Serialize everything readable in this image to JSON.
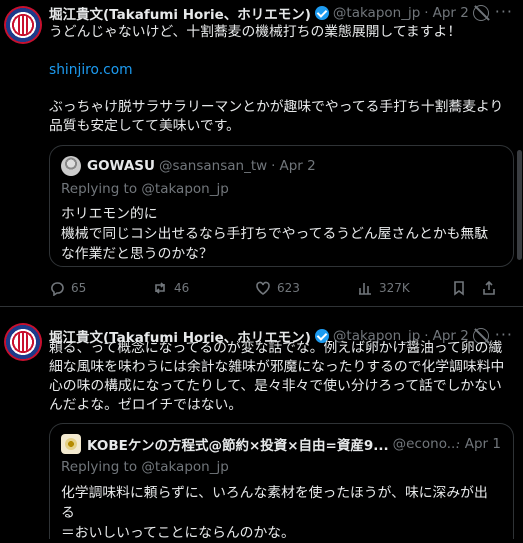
{
  "tweets": [
    {
      "author": "堀江貴文(Takafumi Horie、ホリエモン)",
      "handle": "@takapon_jp",
      "sep": "·",
      "date": "Apr 2",
      "text_line1": "うどんじゃないけど、十割蕎麦の機械打ちの業態展開してますよ！",
      "link": "shinjiro.com",
      "text_line2": "ぶっちゃけ脱サラサラリーマンとかが趣味でやってる手打ち十割蕎麦より",
      "text_line3": "品質も安定してて美味いです。",
      "quote": {
        "author": "GOWASU",
        "handle": "@sansansan_tw",
        "sep": "·",
        "date": "Apr 2",
        "replying": "Replying to @takapon_jp",
        "line1": "ホリエモン的に",
        "line2": "機械で同じコシ出せるなら手打ちでやってるうどん屋さんとかも無駄",
        "line3": "な作業だと思うのかな？"
      },
      "actions": {
        "replies": "65",
        "reposts": "46",
        "likes": "623",
        "views": "327K"
      }
    },
    {
      "author": "堀江貴文(Takafumi Horie、ホリエモン)",
      "handle": "@takapon_jp",
      "sep": "·",
      "date": "Apr 2",
      "text_line1": "頼る、って概念になってるのが変な話でな。例えば卵かけ醤油って卵の繊",
      "text_line2": "細な風味を味わうには余計な雑味が邪魔になったりするので化学調味料中",
      "text_line3": "心の味の構成になってたりして、是々非々で使い分けろって話でしかない",
      "text_line4": "んだよな。ゼロイチではない。",
      "quote": {
        "author": "KOBEケンの方程式@節約×投資×自由=資産9...",
        "handle": "@econo...",
        "sep": "·",
        "date": "Apr 1",
        "replying": "Replying to @takapon_jp",
        "line1": "化学調味料に頼らずに、いろんな素材を使ったほうが、味に深みが出る",
        "line2": "＝おいしいってことにならんのかな。"
      }
    }
  ],
  "colors": {
    "bg": "#000000",
    "text": "#e7e9ea",
    "muted": "#71767b",
    "link": "#1d9bf0",
    "border": "#2f3336"
  },
  "icons": [
    "verified-badge-icon",
    "grok-icon",
    "more-icon",
    "reply-icon",
    "repost-icon",
    "like-icon",
    "views-icon",
    "bookmark-icon",
    "share-icon"
  ]
}
